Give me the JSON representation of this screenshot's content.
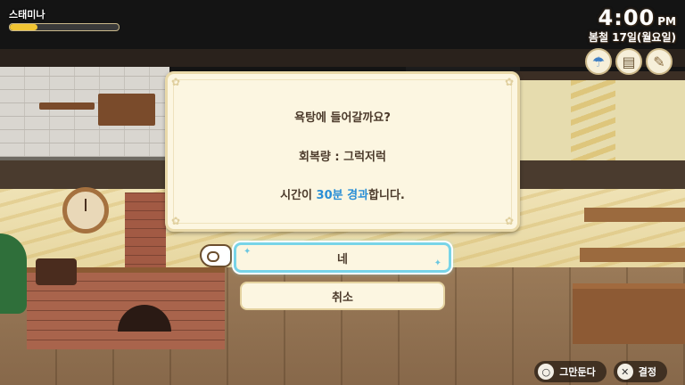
{
  "hud": {
    "stamina_label": "스태미나",
    "stamina_fraction": 0.25,
    "time": "4:00",
    "ampm": "PM",
    "date": "봄철 17일(월요일)",
    "status_icons": [
      "umbrella-icon",
      "calendar-icon",
      "notepad-icon"
    ]
  },
  "dialog": {
    "line1": "욕탕에 들어갈까요?",
    "line2": "회복량 : 그럭저럭",
    "line3_prefix": "시간이 ",
    "line3_highlight": "30분 경과",
    "line3_suffix": "합니다."
  },
  "choices": {
    "yes": "네",
    "no": "취소"
  },
  "hints": {
    "cancel_icon": "○",
    "cancel_label": "그만둔다",
    "confirm_icon": "✕",
    "confirm_label": "결정"
  },
  "colors": {
    "highlight": "#2a8fd6",
    "stamina_fill": "#f2c533",
    "selection_border": "#78d4e8"
  }
}
